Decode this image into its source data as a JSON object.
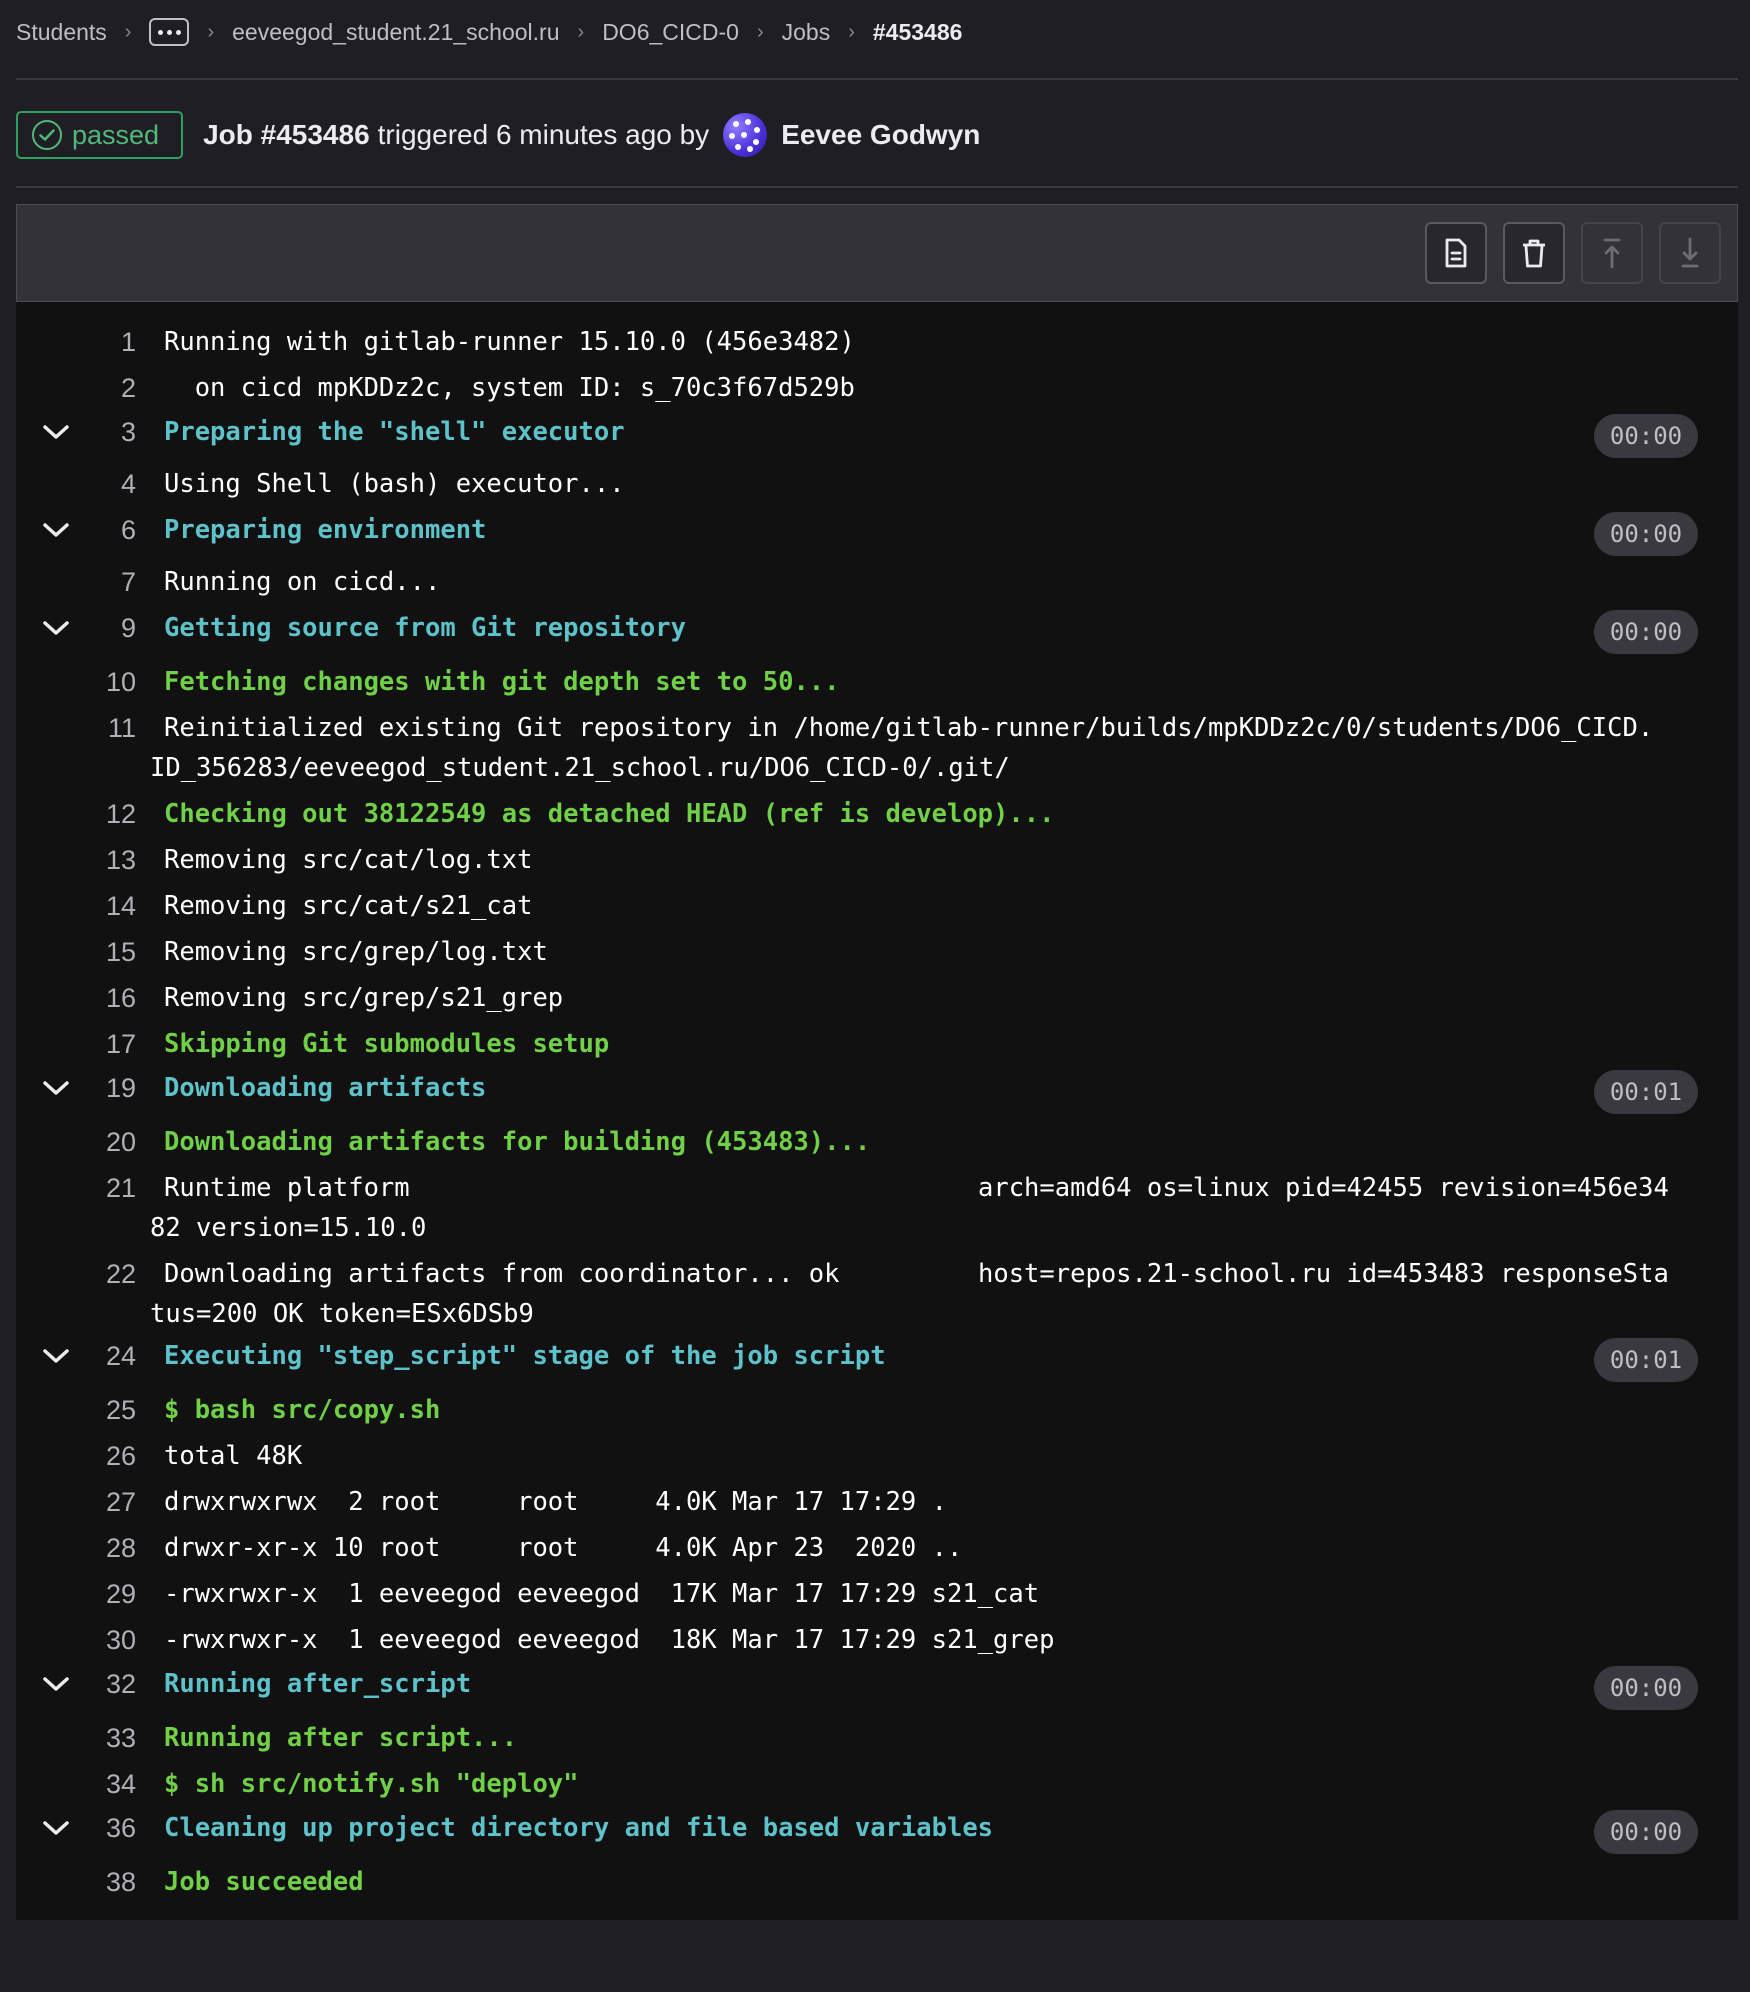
{
  "breadcrumb": {
    "students": "Students",
    "project_path": "eeveegod_student.21_school.ru",
    "project": "DO6_CICD-0",
    "jobs": "Jobs",
    "current": "#453486"
  },
  "header": {
    "status": "passed",
    "job_id": "Job #453486",
    "triggered_text": "triggered 6 minutes ago by",
    "user": "Eevee Godwyn"
  },
  "toolbar": {
    "raw_icon": "document-icon",
    "erase_icon": "trash-icon",
    "scroll_top_icon": "scroll-top-icon",
    "scroll_bottom_icon": "scroll-bottom-icon"
  },
  "colors": {
    "section": "#5ec2ca",
    "success": "#70d047",
    "badge": "#52b87a"
  },
  "log": {
    "l1": {
      "num": "1",
      "text": "Running with gitlab-runner 15.10.0 (456e3482)"
    },
    "l2": {
      "num": "2",
      "text": "  on cicd mpKDDz2c, system ID: s_70c3f67d529b"
    },
    "l3": {
      "num": "3",
      "text": "Preparing the \"shell\" executor",
      "duration": "00:00"
    },
    "l4": {
      "num": "4",
      "text": "Using Shell (bash) executor..."
    },
    "l6": {
      "num": "6",
      "text": "Preparing environment",
      "duration": "00:00"
    },
    "l7": {
      "num": "7",
      "text": "Running on cicd..."
    },
    "l9": {
      "num": "9",
      "text": "Getting source from Git repository",
      "duration": "00:00"
    },
    "l10": {
      "num": "10",
      "text": "Fetching changes with git depth set to 50..."
    },
    "l11": {
      "num": "11",
      "text": "Reinitialized existing Git repository in /home/gitlab-runner/builds/mpKDDz2c/0/students/DO6_CICD.",
      "text2": "ID_356283/eeveegod_student.21_school.ru/DO6_CICD-0/.git/"
    },
    "l12": {
      "num": "12",
      "text": "Checking out 38122549 as detached HEAD (ref is develop)..."
    },
    "l13": {
      "num": "13",
      "text": "Removing src/cat/log.txt"
    },
    "l14": {
      "num": "14",
      "text": "Removing src/cat/s21_cat"
    },
    "l15": {
      "num": "15",
      "text": "Removing src/grep/log.txt"
    },
    "l16": {
      "num": "16",
      "text": "Removing src/grep/s21_grep"
    },
    "l17": {
      "num": "17",
      "text": "Skipping Git submodules setup"
    },
    "l19": {
      "num": "19",
      "text": "Downloading artifacts",
      "duration": "00:01"
    },
    "l20": {
      "num": "20",
      "text": "Downloading artifacts for building (453483)..."
    },
    "l21": {
      "num": "21",
      "text": "Runtime platform",
      "col2": "arch=amd64 os=linux pid=42455 revision=456e34",
      "text2": "82 version=15.10.0"
    },
    "l22": {
      "num": "22",
      "text": "Downloading artifacts from coordinator... ok",
      "col2": "host=repos.21-school.ru id=453483 responseSta",
      "text2": "tus=200 OK token=ESx6DSb9"
    },
    "l24": {
      "num": "24",
      "text": "Executing \"step_script\" stage of the job script",
      "duration": "00:01"
    },
    "l25": {
      "num": "25",
      "text": "$ bash src/copy.sh"
    },
    "l26": {
      "num": "26",
      "text": "total 48K"
    },
    "l27": {
      "num": "27",
      "text": "drwxrwxrwx  2 root     root     4.0K Mar 17 17:29 ."
    },
    "l28": {
      "num": "28",
      "text": "drwxr-xr-x 10 root     root     4.0K Apr 23  2020 .."
    },
    "l29": {
      "num": "29",
      "text": "-rwxrwxr-x  1 eeveegod eeveegod  17K Mar 17 17:29 s21_cat"
    },
    "l30": {
      "num": "30",
      "text": "-rwxrwxr-x  1 eeveegod eeveegod  18K Mar 17 17:29 s21_grep"
    },
    "l32": {
      "num": "32",
      "text": "Running after_script",
      "duration": "00:00"
    },
    "l33": {
      "num": "33",
      "text": "Running after script..."
    },
    "l34": {
      "num": "34",
      "text": "$ sh src/notify.sh \"deploy\""
    },
    "l36": {
      "num": "36",
      "text": "Cleaning up project directory and file based variables",
      "duration": "00:00"
    },
    "l38": {
      "num": "38",
      "text": "Job succeeded"
    }
  }
}
